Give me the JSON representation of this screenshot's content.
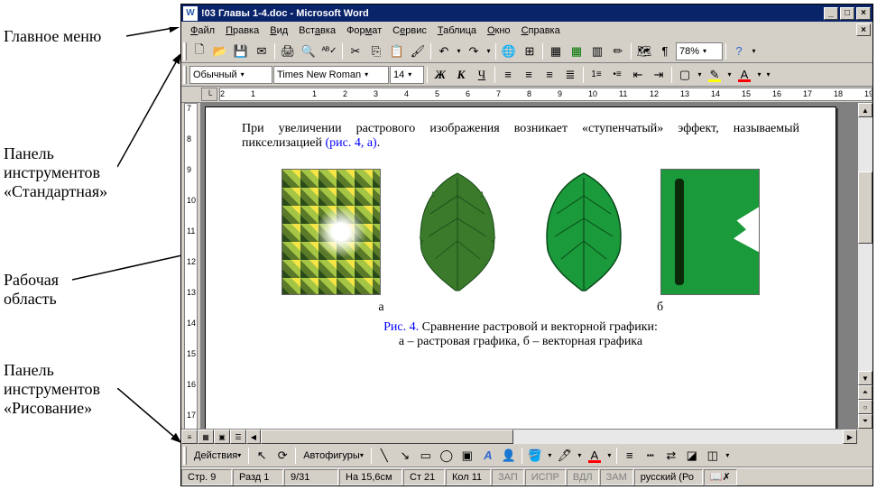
{
  "labels": {
    "main_menu": "Главное меню",
    "toolbar_std": "Панель\nинструментов\n«Стандартная»",
    "work_area": "Рабочая\nобласть",
    "toolbar_draw": "Панель\nинструментов\n«Рисование»"
  },
  "title": "!03 Главы 1-4.doc - Microsoft Word",
  "menu": [
    "Файл",
    "Правка",
    "Вид",
    "Вставка",
    "Формат",
    "Сервис",
    "Таблица",
    "Окно",
    "Справка"
  ],
  "toolbar_std": {
    "zoom": "78%"
  },
  "toolbar_fmt": {
    "style": "Обычный",
    "font": "Times New Roman",
    "size": "14",
    "bold": "Ж",
    "italic": "К",
    "under": "Ч",
    "font_color_letter": "А"
  },
  "ruler_h": [
    "2",
    "1",
    "",
    "1",
    "2",
    "3",
    "4",
    "5",
    "6",
    "7",
    "8",
    "9",
    "10",
    "11",
    "12",
    "13",
    "14",
    "15",
    "16",
    "17",
    "18",
    "19"
  ],
  "ruler_v": [
    "7",
    "8",
    "9",
    "10",
    "11",
    "12",
    "13",
    "14",
    "15",
    "16",
    "17"
  ],
  "document": {
    "para1": "При увеличении растрового изображения возникает «ступенчатый» эффект, называемый пикселизацией ",
    "para1_link": "(рис. 4, а)",
    "fig_a": "а",
    "fig_b": "б",
    "caption_label": "Рис. 4.",
    "caption_text": " Сравнение растровой и векторной графики:",
    "caption_sub": "а – растровая графика, б – векторная графика"
  },
  "drawing_bar": {
    "actions": "Действия",
    "autoshapes": "Автофигуры"
  },
  "status": {
    "page": "Стр. 9",
    "section": "Разд 1",
    "pages": "9/31",
    "pos": "На 15,6см",
    "col": "Ст 21",
    "coln": "Кол 11",
    "rec": "ЗАП",
    "trk": "ИСПР",
    "ext": "ВДЛ",
    "ovr": "ЗАМ",
    "lang": "русский (Ро"
  }
}
